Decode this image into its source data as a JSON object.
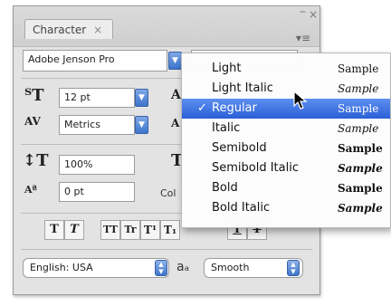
{
  "panel": {
    "tab_title": "Character",
    "tab_close": "×",
    "menu_glyph": "▾≡"
  },
  "font": {
    "family": "Adobe Jenson Pro"
  },
  "size": {
    "font_size": "12 pt",
    "kerning": "Metrics"
  },
  "scale": {
    "vertical": "100%",
    "baseline_shift": "0 pt",
    "color_label_partial": "Col"
  },
  "format_buttons": [
    "T",
    "T",
    "TT",
    "Tr",
    "T¹",
    "T₁",
    "T",
    "T"
  ],
  "bottom": {
    "language": "English: USA",
    "aa_glyph": "aₐ",
    "antialias": "Smooth"
  },
  "menu": {
    "items": [
      {
        "name": "Light",
        "sample": "Sample",
        "style": "normal",
        "weight": "normal"
      },
      {
        "name": "Light Italic",
        "sample": "Sample",
        "style": "italic",
        "weight": "normal"
      },
      {
        "name": "Regular",
        "sample": "Sample",
        "style": "normal",
        "weight": "normal",
        "selected": true,
        "check": "✓"
      },
      {
        "name": "Italic",
        "sample": "Sample",
        "style": "italic",
        "weight": "normal"
      },
      {
        "name": "Semibold",
        "sample": "Sample",
        "style": "normal",
        "weight": "bold"
      },
      {
        "name": "Semibold Italic",
        "sample": "Sample",
        "style": "italic",
        "weight": "bold"
      },
      {
        "name": "Bold",
        "sample": "Sample",
        "style": "normal",
        "weight": "bold"
      },
      {
        "name": "Bold Italic",
        "sample": "Sample",
        "style": "italic",
        "weight": "bold"
      }
    ]
  },
  "colors": {
    "selection": "#3a6ee0",
    "panel_bg": "#e3e3e3"
  }
}
